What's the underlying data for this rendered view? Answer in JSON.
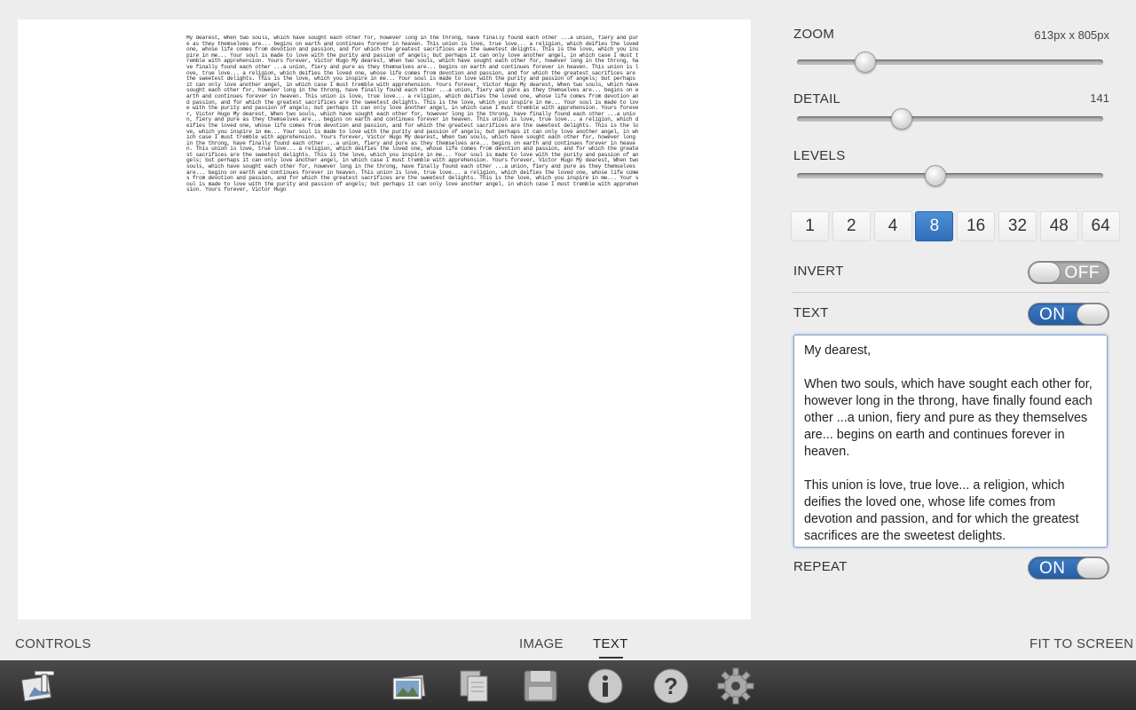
{
  "canvas": {
    "art_text": "My dearest, When two souls, which have sought each other for, however long in the throng, have finally found each other ...a union, fiery and pure as they themselves are... begins on earth and continues forever in heaven. This union is love, true love... a religion, which deifies the loved one, whose life comes from devotion and passion, and for which the greatest sacrifices are the sweetest delights. This is the love, which you inspire in me... Your soul is made to love with the purity and passion of angels; but perhaps it can only love another angel, in which case I must tremble with apprehension. Yours forever, Victor Hugo My dearest, When two souls, which have sought each other for, however long in the throng, have finally found each other ...a union, fiery and pure as they themselves are... begins on earth and continues forever in heaven. This union is love, true love... a religion, which deifies the loved one, whose life comes from devotion and passion, and for which the greatest sacrifices are the sweetest delights. This is the love, which you inspire in me... Your soul is made to love with the purity and passion of angels; but perhaps it can only love another angel, in which case I must tremble with apprehension. Yours forever, Victor Hugo My dearest, When two souls, which have sought each other for, however long in the throng, have finally found each other ...a union, fiery and pure as they themselves are... begins on earth and continues forever in heaven. This union is love, true love... a religion, which deifies the loved one, whose life comes from devotion and passion, and for which the greatest sacrifices are the sweetest delights. This is the love, which you inspire in me... Your soul is made to love with the purity and passion of angels; but perhaps it can only love another angel, in which case I must tremble with apprehension. Yours forever, Victor Hugo My dearest, When two souls, which have sought each other for, however long in the throng, have finally found each other ...a union, fiery and pure as they themselves are... begins on earth and continues forever in heaven. This union is love, true love... a religion, which deifies the loved one, whose life comes from devotion and passion, and for which the greatest sacrifices are the sweetest delights. This is the love, which you inspire in me... Your soul is made to love with the purity and passion of angels; but perhaps it can only love another angel, in which case I must tremble with apprehension. Yours forever, Victor Hugo My dearest, When two souls, which have sought each other for, however long in the throng, have finally found each other ...a union, fiery and pure as they themselves are... begins on earth and continues forever in heaven. This union is love, true love... a religion, which deifies the loved one, whose life comes from devotion and passion, and for which the greatest sacrifices are the sweetest delights. This is the love, which you inspire in me... Your soul is made to love with the purity and passion of angels; but perhaps it can only love another angel, in which case I must tremble with apprehension. Yours forever, Victor Hugo My dearest, When two souls, which have sought each other for, however long in the throng, have finally found each other ...a union, fiery and pure as they themselves are... begins on earth and continues forever in heaven. This union is love, true love... a religion, which deifies the loved one, whose life comes from devotion and passion, and for which the greatest sacrifices are the sweetest delights. This is the love, which you inspire in me... Your soul is made to love with the purity and passion of angels; but perhaps it can only love another angel, in which case I must tremble with apprehension. Yours forever, Victor Hugo"
  },
  "controls": {
    "zoom": {
      "label": "ZOOM",
      "value_text": "613px x 805px",
      "level": 0.2
    },
    "detail": {
      "label": "DETAIL",
      "value_text": "141",
      "level": 0.32
    },
    "levels": {
      "label": "LEVELS",
      "level": 0.43
    },
    "level_options": [
      "1",
      "2",
      "4",
      "8",
      "16",
      "32",
      "48",
      "64"
    ],
    "selected_level": "8",
    "invert": {
      "label": "INVERT",
      "state_text": "OFF"
    },
    "text": {
      "label": "TEXT",
      "state_text": "ON"
    },
    "text_content": "My dearest, \n\nWhen two souls, which have sought each other for, however long in the throng, have finally found each other ...a union, fiery and pure as they themselves are... begins on earth and continues forever in heaven.\n\nThis union is love, true love... a religion, which deifies the loved one, whose life comes from devotion and passion, and for which the greatest sacrifices are the sweetest delights.",
    "repeat": {
      "label": "REPEAT",
      "state_text": "ON"
    }
  },
  "bottom_bar": {
    "controls_label": "CONTROLS",
    "tab_image": "IMAGE",
    "tab_text": "TEXT",
    "fit_label": "FIT TO SCREEN"
  },
  "toolbar": {
    "icons": [
      "app-logo-icon",
      "photos-icon",
      "copy-icon",
      "save-icon",
      "info-icon",
      "help-icon",
      "settings-icon"
    ]
  },
  "colors": {
    "accent": "#3a7cc9",
    "toolbar": "#333333",
    "background": "#ededed"
  }
}
